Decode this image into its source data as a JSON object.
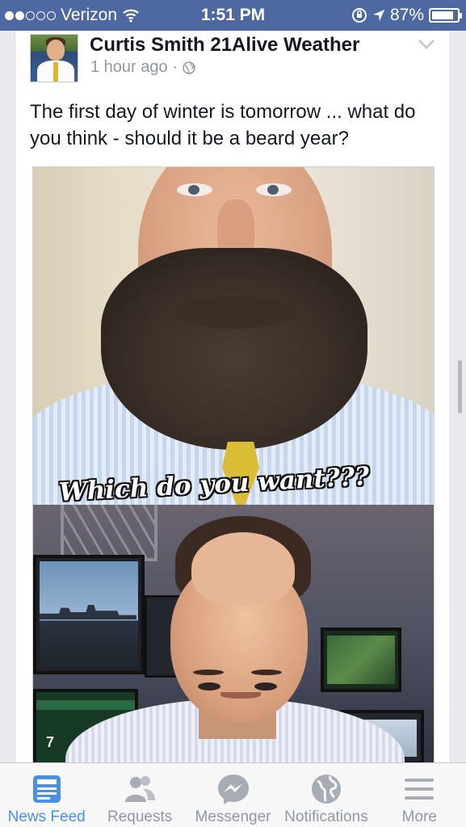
{
  "status_bar": {
    "carrier": "Verizon",
    "time": "1:51 PM",
    "battery_percent": "87%",
    "battery_level": 0.87,
    "signal_bars_filled": 2,
    "signal_bars_total": 5
  },
  "post": {
    "author": "Curtis Smith 21Alive Weather",
    "timestamp": "1 hour ago",
    "separator": "·",
    "privacy_icon": "globe-icon",
    "text": "The first day of winter is tomorrow ... what do you think - should it be a beard year?",
    "photo_caption": "Which do you want???",
    "photo_inset_number": "7"
  },
  "tab_bar": {
    "active_color": "#4a90e2",
    "inactive_color": "#9197a3",
    "tabs": [
      {
        "label": "News Feed",
        "icon": "news-feed-icon",
        "active": true
      },
      {
        "label": "Requests",
        "icon": "friend-requests-icon",
        "active": false
      },
      {
        "label": "Messenger",
        "icon": "messenger-icon",
        "active": false
      },
      {
        "label": "Notifications",
        "icon": "globe-icon",
        "active": false
      },
      {
        "label": "More",
        "icon": "hamburger-menu-icon",
        "active": false
      }
    ]
  },
  "colors": {
    "brand_bar": "#4e69a2",
    "background": "#e9eaee"
  }
}
